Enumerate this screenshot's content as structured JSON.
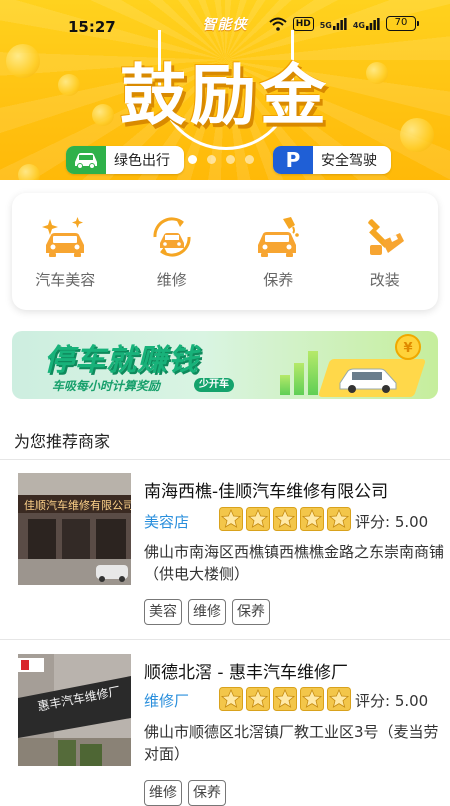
{
  "status_bar": {
    "time": "15:27",
    "hd": "HD",
    "signal1": "5G",
    "signal2": "4G",
    "battery": "70"
  },
  "banner": {
    "app_logo": "智能侠",
    "headline": "鼓励金",
    "left_pill": "绿色出行",
    "right_pill": "安全驾驶",
    "right_pill_icon": "P",
    "slide_count": 4,
    "active_slide": 1
  },
  "services": [
    {
      "label": "汽车美容",
      "icon": "car-wash-icon"
    },
    {
      "label": "维修",
      "icon": "repair-icon"
    },
    {
      "label": "保养",
      "icon": "maintenance-icon"
    },
    {
      "label": "改装",
      "icon": "modification-icon"
    }
  ],
  "ad": {
    "title": "停车就赚钱",
    "subtitle": "车吸每小时计算奖励",
    "tag": "少开车"
  },
  "recommend": {
    "title": "为您推荐商家",
    "shops": [
      {
        "name": "南海西樵-佳顺汽车维修有限公司",
        "type": "美容店",
        "stars": 5,
        "rating": "评分: 5.00",
        "address": "佛山市南海区西樵镇西樵樵金路之东崇南商铺（供电大楼侧）",
        "tags": [
          "美容",
          "维修",
          "保养"
        ],
        "sign_text": "佳顺汽车维修有限公司"
      },
      {
        "name": "顺德北滘 - 惠丰汽车维修厂",
        "type": "维修厂",
        "stars": 5,
        "rating": "评分: 5.00",
        "address": "佛山市顺德区北滘镇厂教工业区3号（麦当劳对面）",
        "tags": [
          "维修",
          "保养"
        ],
        "sign_text": "惠丰汽车维修厂"
      }
    ]
  },
  "colors": {
    "brand_yellow": "#ffc312",
    "accent_orange": "#f5a623",
    "link_blue": "#2a8fdc",
    "green": "#2fb14a",
    "blue": "#1f5fd6",
    "ad_green": "#18b27a"
  }
}
